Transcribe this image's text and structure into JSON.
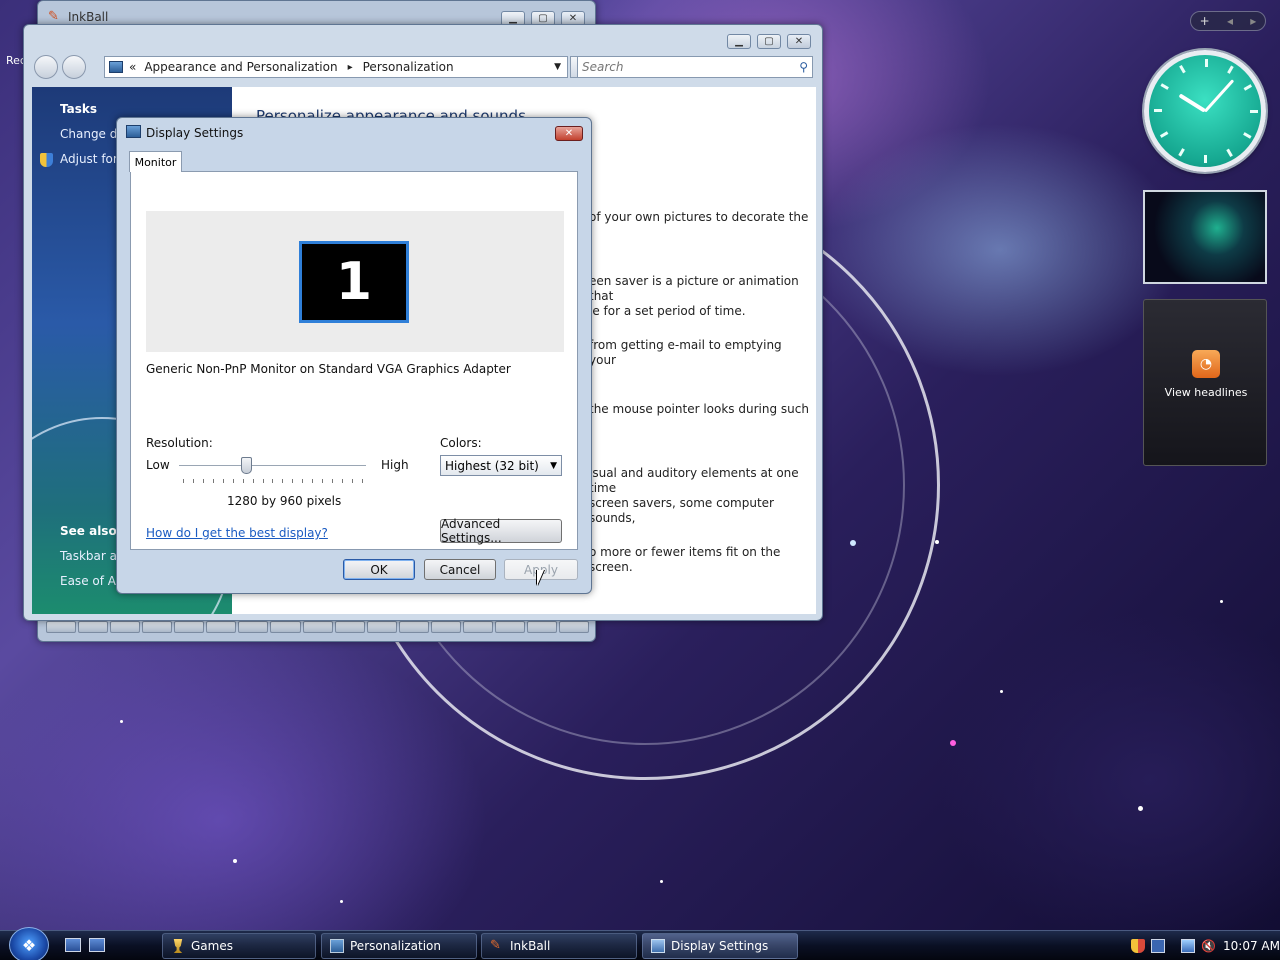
{
  "desktop": {
    "left_edge_text": "Rec"
  },
  "inkball": {
    "title": "InkBall"
  },
  "personalization": {
    "address": {
      "chevrons": "«",
      "crumb1": "Appearance and Personalization",
      "separator": "▸",
      "crumb2": "Personalization"
    },
    "search_placeholder": "Search",
    "sidebar": {
      "tasks_heading": "Tasks",
      "task1": "Change de",
      "task2": "Adjust font",
      "see_also_heading": "See also",
      "see_also1": "Taskbar an",
      "see_also2": "Ease of Ac"
    },
    "content": {
      "heading": "Personalize appearance and sounds",
      "desc1a": "of your own pictures to decorate the",
      "desc2a": "een saver is a picture or animation that",
      "desc2b": "le for a set period of time.",
      "desc3a": "from getting e-mail to emptying your",
      "desc4a": "the mouse pointer looks during such",
      "desc5a": "isual and auditory elements at one time",
      "desc5b": "screen savers, some computer sounds,",
      "desc6a": "o more or fewer items fit on the screen."
    }
  },
  "display_settings": {
    "title": "Display Settings",
    "tab": "Monitor",
    "monitor_number": "1",
    "monitor_name": "Generic Non-PnP Monitor on Standard VGA Graphics Adapter",
    "resolution_label": "Resolution:",
    "low": "Low",
    "high": "High",
    "resolution_value": "1280 by 960 pixels",
    "colors_label": "Colors:",
    "colors_value": "Highest (32 bit)",
    "help_link": "How do I get the best display?",
    "advanced_button": "Advanced Settings...",
    "ok": "OK",
    "cancel": "Cancel",
    "apply": "Apply"
  },
  "gadgets": {
    "feed_text": "View headlines"
  },
  "taskbar": {
    "items": [
      {
        "label": "Games"
      },
      {
        "label": "Personalization"
      },
      {
        "label": "InkBall"
      },
      {
        "label": "Display Settings"
      }
    ],
    "clock": "10:07 AM"
  },
  "colors": {
    "accent": "#2f7fd8",
    "link": "#1a5bc2",
    "clock_face": "#16a891"
  }
}
